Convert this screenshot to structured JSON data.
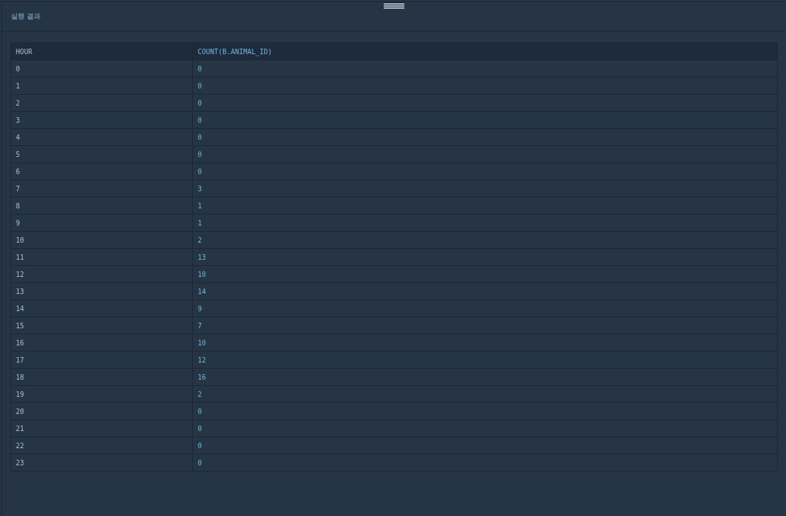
{
  "panel": {
    "title": "실행 결과"
  },
  "table": {
    "columns": [
      "HOUR",
      "COUNT(B.ANIMAL_ID)"
    ],
    "rows": [
      [
        "0",
        "0"
      ],
      [
        "1",
        "0"
      ],
      [
        "2",
        "0"
      ],
      [
        "3",
        "0"
      ],
      [
        "4",
        "0"
      ],
      [
        "5",
        "0"
      ],
      [
        "6",
        "0"
      ],
      [
        "7",
        "3"
      ],
      [
        "8",
        "1"
      ],
      [
        "9",
        "1"
      ],
      [
        "10",
        "2"
      ],
      [
        "11",
        "13"
      ],
      [
        "12",
        "10"
      ],
      [
        "13",
        "14"
      ],
      [
        "14",
        "9"
      ],
      [
        "15",
        "7"
      ],
      [
        "16",
        "10"
      ],
      [
        "17",
        "12"
      ],
      [
        "18",
        "16"
      ],
      [
        "19",
        "2"
      ],
      [
        "20",
        "0"
      ],
      [
        "21",
        "0"
      ],
      [
        "22",
        "0"
      ],
      [
        "23",
        "0"
      ]
    ]
  }
}
